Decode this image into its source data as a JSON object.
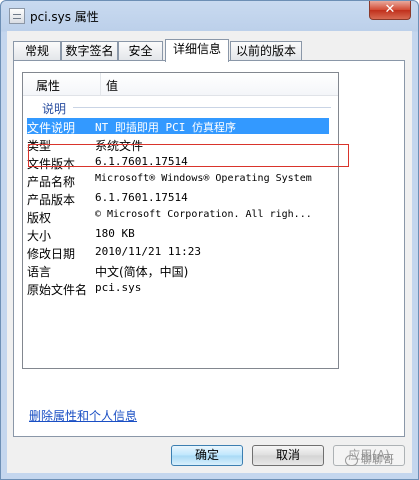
{
  "window": {
    "title": "pci.sys 属性",
    "close_label": "✕"
  },
  "tabs": [
    {
      "label": "常规"
    },
    {
      "label": "数字签名"
    },
    {
      "label": "安全"
    },
    {
      "label": "详细信息"
    },
    {
      "label": "以前的版本"
    }
  ],
  "details": {
    "header": {
      "name": "属性",
      "value": "值"
    },
    "group": "说明",
    "rows": [
      {
        "name": "文件说明",
        "value": "NT 即插即用 PCI 仿真程序"
      },
      {
        "name": "类型",
        "value": "系统文件"
      },
      {
        "name": "文件版本",
        "value": "6.1.7601.17514"
      },
      {
        "name": "产品名称",
        "value": "Microsoft® Windows® Operating System"
      },
      {
        "name": "产品版本",
        "value": "6.1.7601.17514"
      },
      {
        "name": "版权",
        "value": "© Microsoft Corporation. All righ..."
      },
      {
        "name": "大小",
        "value": "180 KB"
      },
      {
        "name": "修改日期",
        "value": "2010/11/21 11:23"
      },
      {
        "name": "语言",
        "value": "中文(简体，中国)"
      },
      {
        "name": "原始文件名",
        "value": "pci.sys"
      }
    ]
  },
  "remove_link": "删除属性和个人信息",
  "buttons": {
    "ok": "确定",
    "cancel": "取消",
    "apply": "应用(A)"
  },
  "watermark": "聊聊哥"
}
